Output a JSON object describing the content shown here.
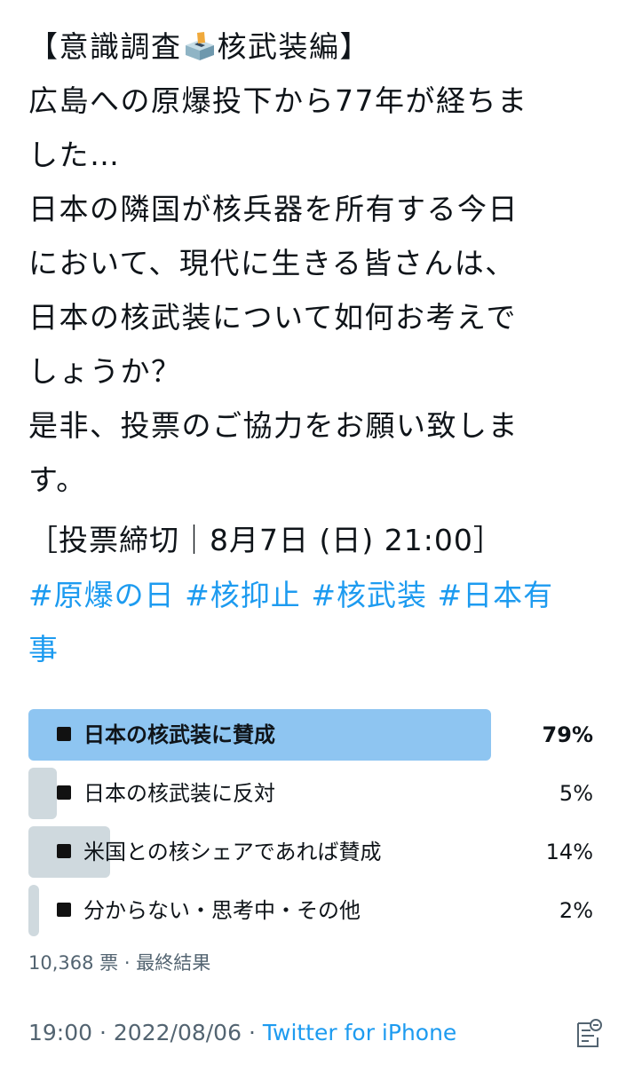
{
  "tweet": {
    "lines": [
      {
        "before": "【意識調査",
        "icon": "ballot-box-icon",
        "after": "核武装編】"
      },
      "広島への原爆投下から77年が経ちま",
      "した…",
      "日本の隣国が核兵器を所有する今日",
      "において、現代に生きる皆さんは、",
      "日本の核武装について如何お考えで",
      "しょうか？",
      "是非、投票のご協力をお願い致しま",
      "す。"
    ],
    "deadline": "［投票締切｜8月7日 (日) 21:00］",
    "hashtags": [
      "#原爆の日",
      "#核抑止",
      "#核武装",
      "#日本有事"
    ]
  },
  "poll": {
    "options": [
      {
        "label": "日本の核武装に賛成",
        "percent_text": "79%",
        "percent": 79,
        "winner": true
      },
      {
        "label": "日本の核武装に反対",
        "percent_text": "5%",
        "percent": 5,
        "winner": false
      },
      {
        "label": "米国との核シェアであれば賛成",
        "percent_text": "14%",
        "percent": 14,
        "winner": false
      },
      {
        "label": "分からない・思考中・その他",
        "percent_text": "2%",
        "percent": 2,
        "winner": false
      }
    ],
    "votes": "10,368 票",
    "separator": "·",
    "status": "最終結果"
  },
  "meta": {
    "time": "19:00",
    "separator": "·",
    "date": "2022/08/06",
    "source": "Twitter for iPhone",
    "analytics_icon": "analytics-icon"
  },
  "colors": {
    "link": "#1d9bf0",
    "winner_bar": "#8ec5f1",
    "bar": "#cfd9de",
    "muted": "#536471"
  }
}
